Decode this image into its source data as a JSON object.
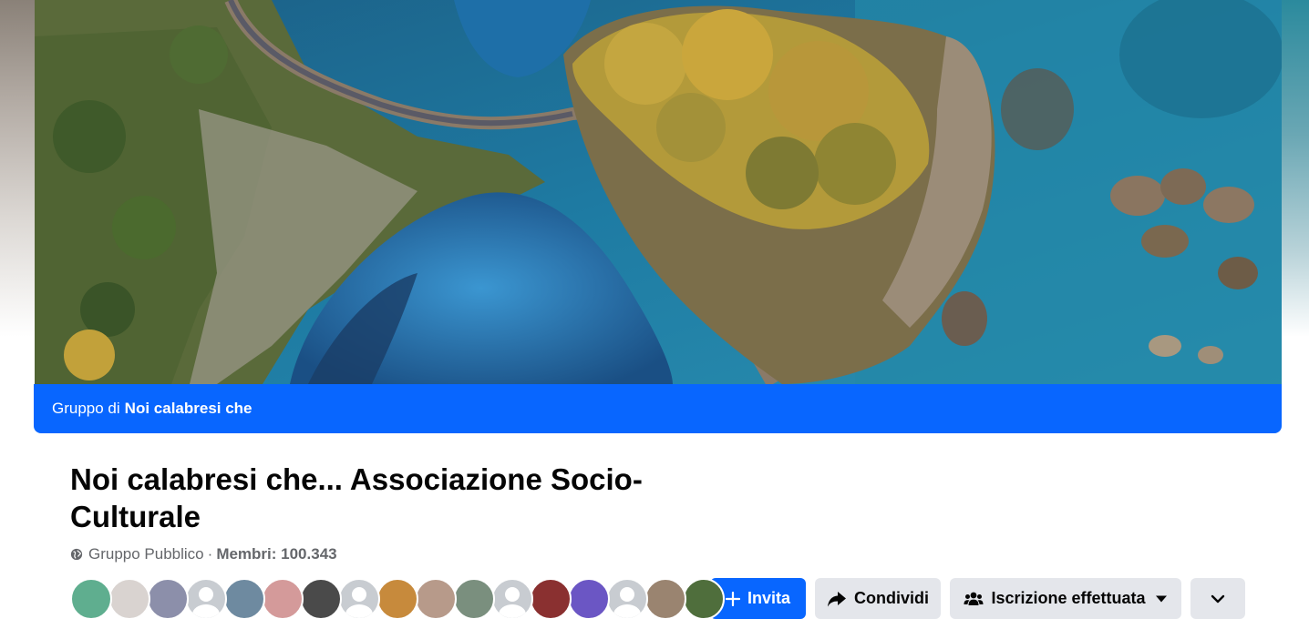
{
  "cover": {
    "description_icon": "cover-photo",
    "owner_prefix": "Gruppo di",
    "owner_name": "Noi calabresi che"
  },
  "group": {
    "title": "Noi calabresi che... Associazione Socio-Culturale",
    "privacy": "Gruppo Pubblico",
    "separator": "·",
    "members_label": "Membri: 100.343"
  },
  "member_avatars": [
    {
      "color": "#5fae8f"
    },
    {
      "color": "#d9d3d0"
    },
    {
      "color": "#8c8faa"
    },
    {
      "color": "#c8ccd1",
      "blank": true
    },
    {
      "color": "#6e8aa0"
    },
    {
      "color": "#d49a9a"
    },
    {
      "color": "#4a4a4a"
    },
    {
      "color": "#c8ccd1",
      "blank": true
    },
    {
      "color": "#c78a3c"
    },
    {
      "color": "#b79a8a"
    },
    {
      "color": "#7a8f7e"
    },
    {
      "color": "#c8ccd1",
      "blank": true
    },
    {
      "color": "#8a3030"
    },
    {
      "color": "#6b56c4"
    },
    {
      "color": "#c8ccd1",
      "blank": true
    },
    {
      "color": "#9a8470"
    },
    {
      "color": "#4f6e3c"
    }
  ],
  "actions": {
    "invite_label": "Invita",
    "share_label": "Condividi",
    "joined_label": "Iscrizione effettuata",
    "more_icon": "chevron-down-icon"
  },
  "colors": {
    "accent": "#0866ff",
    "secondary_button": "#e4e6eb",
    "muted_text": "#65676b"
  }
}
